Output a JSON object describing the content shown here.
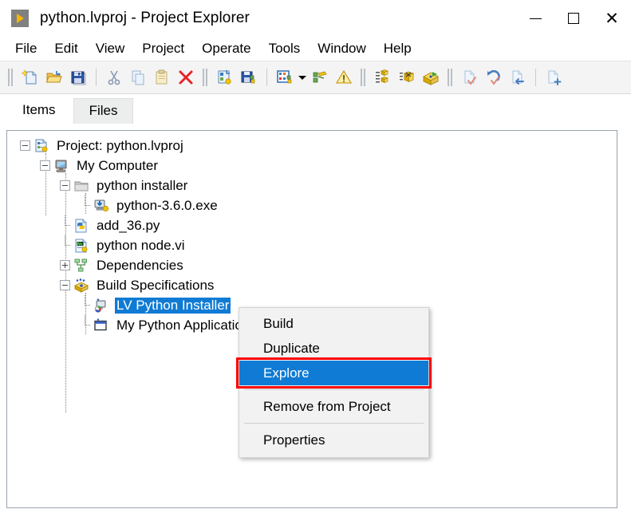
{
  "window": {
    "title": "python.lvproj - Project Explorer",
    "app_icon": "labview-icon",
    "controls": {
      "minimize": "—",
      "maximize": "□",
      "close": "✕"
    }
  },
  "menubar": {
    "items": [
      {
        "label": "File"
      },
      {
        "label": "Edit"
      },
      {
        "label": "View"
      },
      {
        "label": "Project"
      },
      {
        "label": "Operate"
      },
      {
        "label": "Tools"
      },
      {
        "label": "Window"
      },
      {
        "label": "Help"
      }
    ]
  },
  "toolbar": {
    "groups": [
      {
        "buttons": [
          {
            "icon": "new-project-icon"
          },
          {
            "icon": "open-project-icon"
          },
          {
            "icon": "save-project-icon"
          }
        ]
      },
      {
        "buttons": [
          {
            "icon": "cut-icon"
          },
          {
            "icon": "copy-icon"
          },
          {
            "icon": "paste-icon"
          },
          {
            "icon": "delete-icon"
          }
        ]
      },
      {
        "buttons": [
          {
            "icon": "add-item-icon"
          },
          {
            "icon": "save-all-icon"
          }
        ]
      },
      {
        "buttons": [
          {
            "icon": "project-view-icon"
          },
          {
            "icon": "dropdown-arrow-icon"
          },
          {
            "icon": "build-icon"
          },
          {
            "icon": "warning-icon"
          }
        ]
      },
      {
        "buttons": [
          {
            "icon": "source-control-list-icon"
          },
          {
            "icon": "package-icon"
          },
          {
            "icon": "deploy-icon"
          }
        ]
      },
      {
        "buttons": [
          {
            "icon": "check-out-icon"
          },
          {
            "icon": "undo-checkout-icon"
          },
          {
            "icon": "check-in-icon"
          }
        ]
      },
      {
        "buttons": [
          {
            "icon": "add-to-source-control-icon"
          }
        ]
      }
    ]
  },
  "tabs": {
    "items": [
      {
        "label": "Items",
        "active": true
      },
      {
        "label": "Files",
        "active": false
      }
    ]
  },
  "tree": {
    "nodes": [
      {
        "label": "Project: python.lvproj",
        "icon": "project-icon",
        "depth": 0,
        "expander": "minus",
        "selected": false
      },
      {
        "label": "My Computer",
        "icon": "my-computer-icon",
        "depth": 1,
        "expander": "minus",
        "selected": false
      },
      {
        "label": "python installer",
        "icon": "folder-icon",
        "depth": 2,
        "expander": "minus",
        "selected": false
      },
      {
        "label": "python-3.6.0.exe",
        "icon": "installer-exe-icon",
        "depth": 3,
        "expander": "none",
        "selected": false
      },
      {
        "label": "add_36.py",
        "icon": "python-file-icon",
        "depth": 2,
        "expander": "none",
        "selected": false
      },
      {
        "label": "python node.vi",
        "icon": "vi-file-icon",
        "depth": 2,
        "expander": "none",
        "selected": false
      },
      {
        "label": "Dependencies",
        "icon": "dependencies-icon",
        "depth": 2,
        "expander": "plus",
        "selected": false
      },
      {
        "label": "Build Specifications",
        "icon": "build-specifications-icon",
        "depth": 2,
        "expander": "minus",
        "selected": false
      },
      {
        "label": "LV Python Installer",
        "icon": "installer-build-icon",
        "depth": 3,
        "expander": "none",
        "selected": true
      },
      {
        "label": "My Python Application",
        "icon": "application-build-icon",
        "depth": 3,
        "expander": "none",
        "selected": false
      }
    ]
  },
  "context_menu": {
    "items": [
      {
        "label": "Build",
        "highlighted": false,
        "separator_after": false
      },
      {
        "label": "Duplicate",
        "highlighted": false,
        "separator_after": false
      },
      {
        "label": "Explore",
        "highlighted": true,
        "separator_after": true
      },
      {
        "label": "Remove from Project",
        "highlighted": false,
        "separator_after": true
      },
      {
        "label": "Properties",
        "highlighted": false,
        "separator_after": false
      }
    ]
  },
  "colors": {
    "selection_blue": "#0f7bd4",
    "annotation_red": "#ff0000",
    "toolbar_bg": "#f4f4f4",
    "menu_bg": "#f2f2f2",
    "panel_border": "#9aa3ad"
  }
}
